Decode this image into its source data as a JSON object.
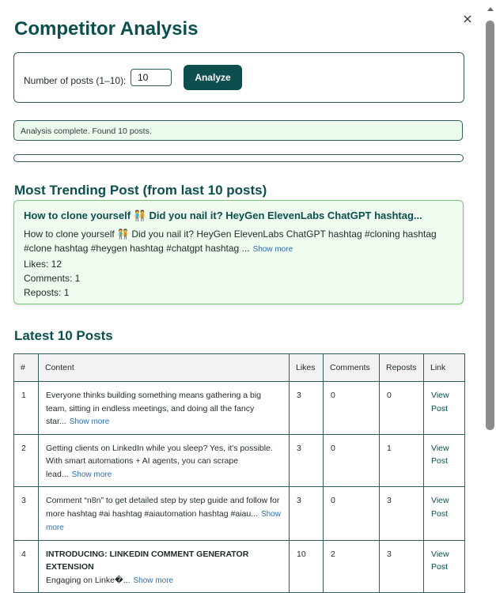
{
  "header": {
    "title": "Competitor Analysis"
  },
  "form": {
    "label": "Number of posts (1–10):",
    "input_value": "10",
    "button_label": "Analyze"
  },
  "status": {
    "message": "Analysis complete. Found 10 posts."
  },
  "progress": {
    "value_percent": 0
  },
  "trending": {
    "heading": "Most Trending Post (from last 10 posts)",
    "title": "How to clone yourself 🧑‍🤝‍🧑 Did you nail it? HeyGen ElevenLabs ChatGPT hashtag...",
    "body": "How to clone yourself 🧑‍🤝‍🧑 Did you nail it? HeyGen ElevenLabs ChatGPT hashtag #cloning hashtag #clone hashtag #heygen hashtag #chatgpt hashtag ...",
    "show_more": "Show more",
    "likes": "Likes: 12",
    "comments": "Comments: 1",
    "reposts": "Reposts: 1"
  },
  "latest": {
    "heading": "Latest 10 Posts",
    "columns": [
      "#",
      "Content",
      "Likes",
      "Comments",
      "Reposts",
      "Link"
    ],
    "rows": [
      {
        "num": "1",
        "content": "Everyone thinks building something means gathering a big team, sitting in endless meetings, and doing all the fancy star...",
        "show_more": "Show more",
        "likes": "3",
        "comments": "0",
        "reposts": "0",
        "link": "View Post"
      },
      {
        "num": "2",
        "content": "Getting clients on LinkedIn while you sleep? Yes, it's possible. With smart automations + AI agents, you can scrape lead...",
        "show_more": "Show more",
        "likes": "3",
        "comments": "0",
        "reposts": "1",
        "link": "View Post"
      },
      {
        "num": "3",
        "content": "Comment “n8n” to get detailed step by step guide and follow for more hashtag #ai hashtag #aiautomation hashtag #aiau...",
        "show_more": "Show more",
        "likes": "3",
        "comments": "0",
        "reposts": "3",
        "link": "View Post"
      },
      {
        "num": "4",
        "content_bold": "INTRODUCING: LINKEDIN COMMENT GENERATOR EXTENSION",
        "content": "Engaging on Linke�...",
        "show_more": "Show more",
        "likes": "10",
        "comments": "2",
        "reposts": "3",
        "link": "View Post"
      }
    ]
  }
}
